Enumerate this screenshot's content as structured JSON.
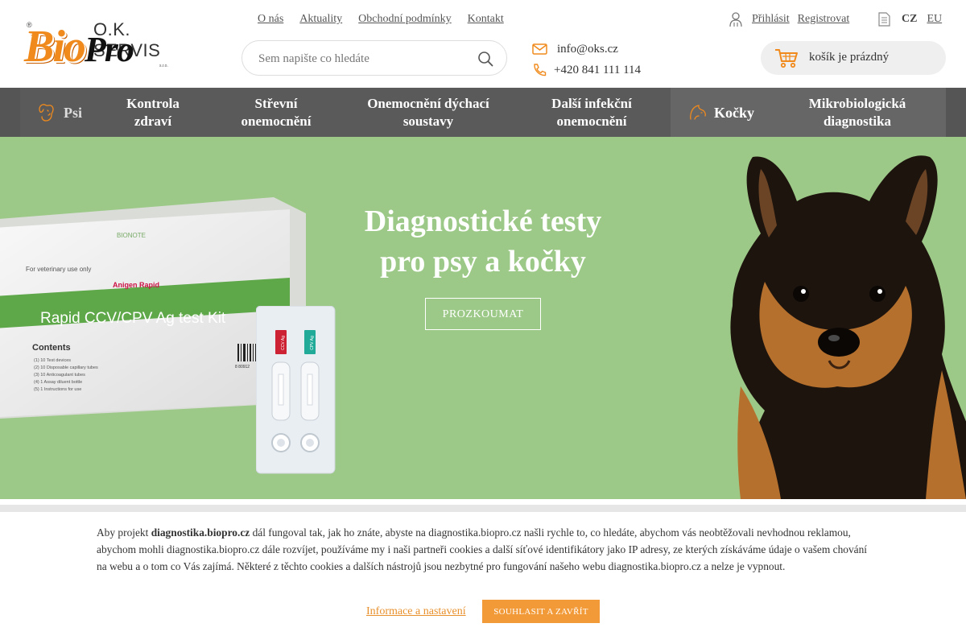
{
  "logo": {
    "company": "O.K. SERVIS",
    "brand_bio": "Bio",
    "brand_pro": "Pro",
    "suffix": "s.r.o.",
    "registered": "®"
  },
  "topnav": [
    "O nás",
    "Aktuality",
    "Obchodní podmínky",
    "Kontakt"
  ],
  "search": {
    "placeholder": "Sem napište co hledáte"
  },
  "contact": {
    "email": "info@oks.cz",
    "phone": "+420 841 111 114"
  },
  "user": {
    "login": "Přihlásit",
    "register": "Registrovat"
  },
  "lang": {
    "active": "CZ",
    "other": "EU"
  },
  "cart": {
    "label": "košík je prázdný"
  },
  "nav": {
    "dogs": "Psi",
    "dog_items": [
      {
        "line1": "Kontrola",
        "line2": "zdraví"
      },
      {
        "line1": "Střevní",
        "line2": "onemocnění"
      },
      {
        "line1": "Onemocnění dýchací",
        "line2": "soustavy"
      },
      {
        "line1": "Další infekční",
        "line2": "onemocnění"
      }
    ],
    "cats": "Kočky",
    "cat_items": [
      {
        "line1": "Mikrobiologická",
        "line2": "diagnostika"
      }
    ]
  },
  "hero": {
    "title_line1": "Diagnostické testy",
    "title_line2": "pro psy a kočky",
    "cta": "PROZKOUMAT",
    "box": {
      "brand": "BIONOTE",
      "use": "For veterinary use only",
      "product_line": "Anigen Rapid",
      "product": "Rapid CCV/CPV Ag test Kit",
      "contents_title": "Contents",
      "contents": [
        "(1) 10 Test devices",
        "(2) 10 Disposable capillary tubes",
        "(3) 10 Anticoagulant tubes",
        "(4) 1 Assay diluent bottle",
        "(5) 1 Instructions for use"
      ],
      "barcode": "8 80912",
      "device_label_1": "CCV Ag",
      "device_label_2": "CPV Ag"
    }
  },
  "cookie": {
    "text_before": "Aby projekt ",
    "domain": "diagnostika.biopro.cz",
    "text_after": " dál fungoval tak, jak ho znáte, abyste na diagnostika.biopro.cz našli rychle to, co hledáte, abychom vás neobtěžovali nevhodnou reklamou, abychom mohli diagnostika.biopro.cz dále rozvíjet, používáme my i naši partneři cookies a další síťové identifikátory jako IP adresy, ze kterých získáváme údaje o vašem chování na webu a o tom co Vás zajímá. Některé z těchto cookies a dalších nástrojů jsou nezbytné pro fungování našeho webu diagnostika.biopro.cz a nelze je vypnout.",
    "info_link": "Informace a nastavení",
    "agree_button": "SOUHLASIT A ZAVŘÍT"
  },
  "colors": {
    "accent": "#f08a1c",
    "nav_bg": "#5a5a5b",
    "hero_bg": "#9cc987",
    "cookie_button": "#f29a38"
  },
  "icons": [
    "search-icon",
    "mail-icon",
    "phone-icon",
    "user-icon",
    "document-icon",
    "cart-icon",
    "dog-icon",
    "cat-icon"
  ]
}
